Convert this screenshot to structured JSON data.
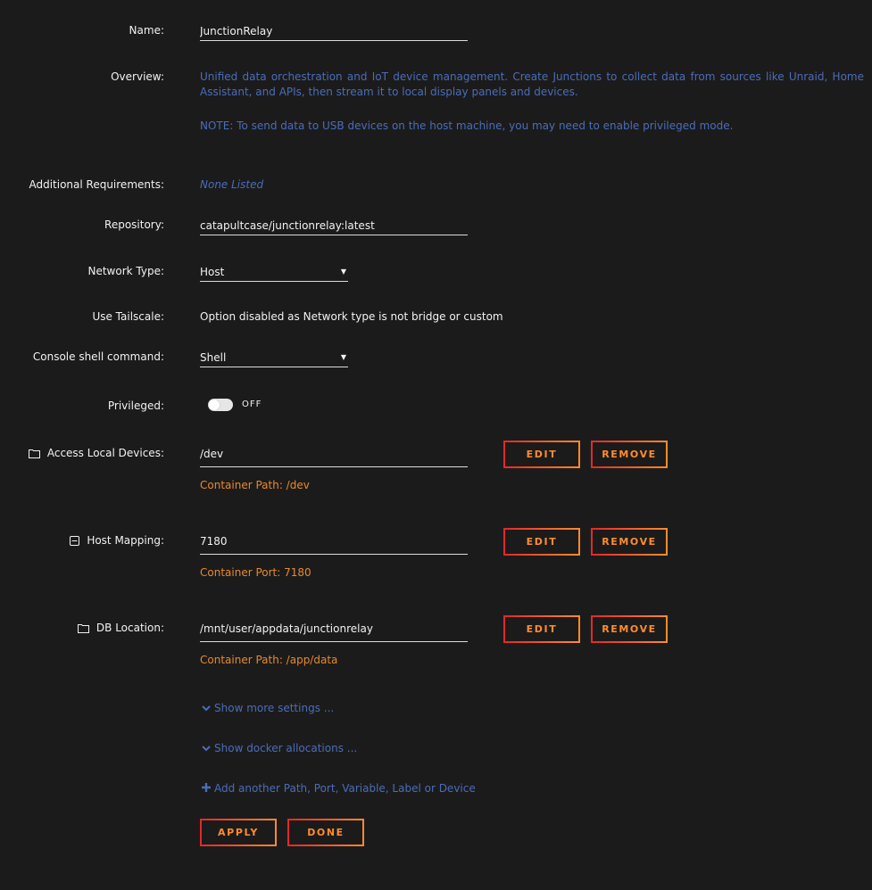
{
  "form": {
    "name": {
      "label": "Name:",
      "value": "JunctionRelay"
    },
    "overview": {
      "label": "Overview:",
      "text": "Unified data orchestration and IoT device management. Create Junctions to collect data from sources like Unraid, Home Assistant, and APIs, then stream it to local display panels and devices.",
      "note": "NOTE: To send data to USB devices on the host machine, you may need to enable privileged mode."
    },
    "requirements": {
      "label": "Additional Requirements:",
      "value": "None Listed"
    },
    "repository": {
      "label": "Repository:",
      "value": "catapultcase/junctionrelay:latest"
    },
    "network_type": {
      "label": "Network Type:",
      "value": "Host"
    },
    "tailscale": {
      "label": "Use Tailscale:",
      "value": "Option disabled as Network type is not bridge or custom"
    },
    "console": {
      "label": "Console shell command:",
      "value": "Shell"
    },
    "privileged": {
      "label": "Privileged:",
      "state": "OFF",
      "enabled": false
    }
  },
  "mappings": [
    {
      "label": "Access Local Devices:",
      "icon": "folder-icon",
      "value": "/dev",
      "note": "Container Path: /dev",
      "edit_label": "EDIT",
      "remove_label": "REMOVE"
    },
    {
      "label": "Host Mapping:",
      "icon": "minus-square-icon",
      "value": "7180",
      "note": "Container Port: 7180",
      "edit_label": "EDIT",
      "remove_label": "REMOVE"
    },
    {
      "label": "DB Location:",
      "icon": "folder-icon",
      "value": "/mnt/user/appdata/junctionrelay",
      "note": "Container Path: /app/data",
      "edit_label": "EDIT",
      "remove_label": "REMOVE"
    }
  ],
  "links": {
    "more_settings": "Show more settings ...",
    "docker_allocations": "Show docker allocations ...",
    "add_another": "Add another Path, Port, Variable, Label or Device"
  },
  "actions": {
    "apply": "APPLY",
    "done": "DONE"
  },
  "colors": {
    "background": "#1c1b1b",
    "link_blue": "#486dba",
    "note_orange": "#e68a2e",
    "button_gradient_start": "#e22828",
    "button_gradient_end": "#ff8c2f"
  }
}
